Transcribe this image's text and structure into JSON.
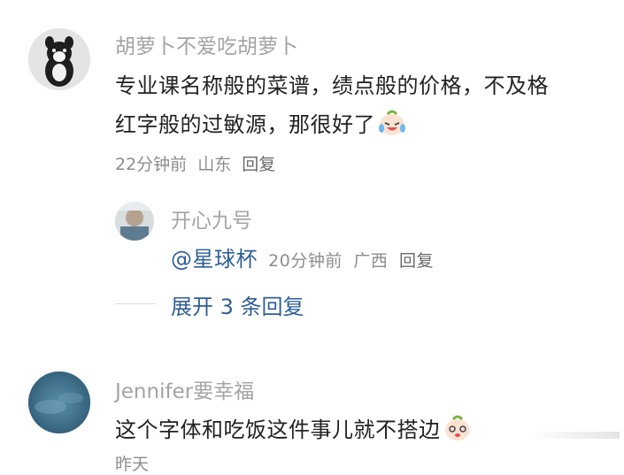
{
  "comments": [
    {
      "username": "胡萝卜不爱吃胡萝卜",
      "text_line1": "专业课名称般的菜谱，绩点般的价格，不及格",
      "text_line2": "红字般的过敏源，那很好了",
      "time": "22分钟前",
      "location": "山东",
      "reply_label": "回复",
      "emoji": "crying-laughing-emoji"
    },
    {
      "username": "Jennifer要幸福",
      "text": "这个字体和吃饭这件事儿就不搭边",
      "emoji": "crying-laughing-emoji",
      "partial_meta": "昨天"
    }
  ],
  "reply": {
    "username": "开心九号",
    "mention": "@星球杯",
    "time": "20分钟前",
    "location": "广西",
    "reply_label": "回复"
  },
  "expand": {
    "label": "展开 3 条回复"
  },
  "colors": {
    "link": "#2f5f98",
    "username": "#a4a4a4",
    "meta": "#8d8d8d"
  }
}
